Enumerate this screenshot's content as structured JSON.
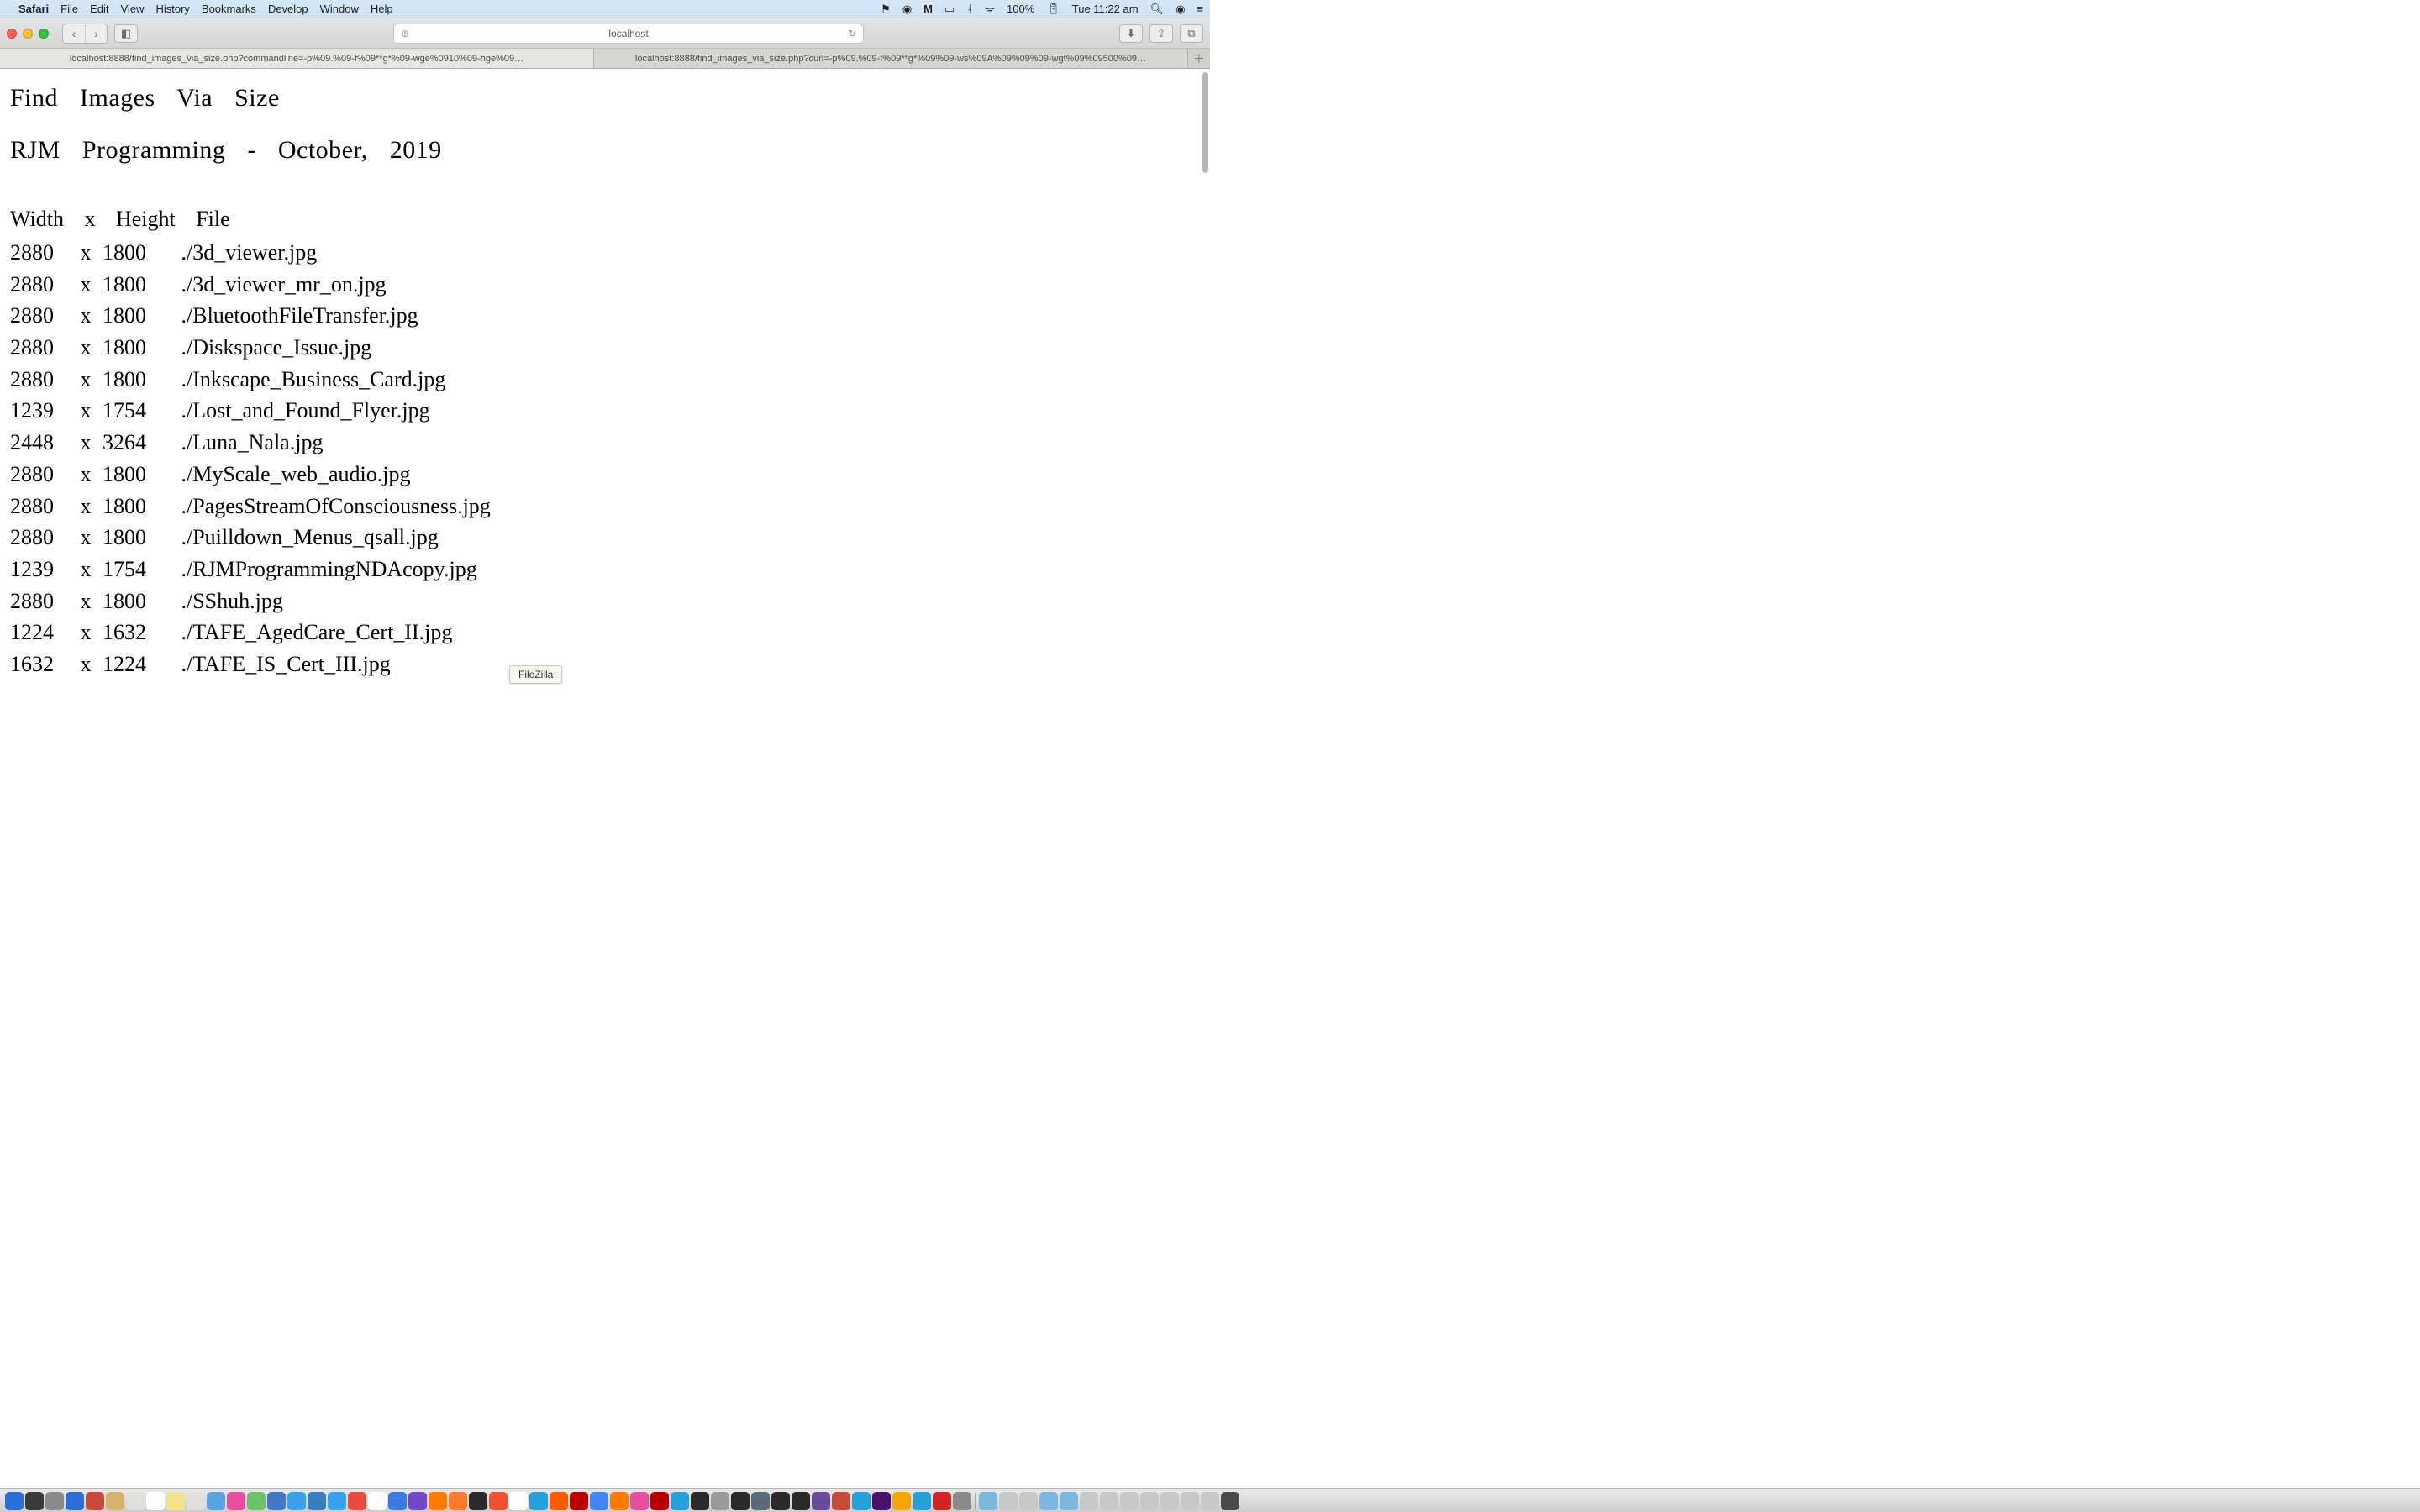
{
  "menubar": {
    "app": "Safari",
    "items": [
      "File",
      "Edit",
      "View",
      "History",
      "Bookmarks",
      "Develop",
      "Window",
      "Help"
    ],
    "battery": "100%",
    "clock": "Tue 11:22 am"
  },
  "toolbar": {
    "address": "localhost"
  },
  "tabs": [
    {
      "label": "localhost:8888/find_images_via_size.php?commandline=-p%09.%09-f%09**g*%09-wge%0910%09-hge%09…",
      "active": true
    },
    {
      "label": "localhost:8888/find_images_via_size.php?curl=-p%09.%09-f%09**g*%09%09-ws%09A%09%09%09-wgt%09%09500%09…",
      "active": false
    }
  ],
  "page": {
    "title": "Find   Images   Via   Size",
    "subtitle": "RJM   Programming   -   October,   2019",
    "columns": "Width   x   Height   File",
    "rows": [
      {
        "width": "2880",
        "height": "1800",
        "file": "./3d_viewer.jpg"
      },
      {
        "width": "2880",
        "height": "1800",
        "file": "./3d_viewer_mr_on.jpg"
      },
      {
        "width": "2880",
        "height": "1800",
        "file": "./BluetoothFileTransfer.jpg"
      },
      {
        "width": "2880",
        "height": "1800",
        "file": "./Diskspace_Issue.jpg"
      },
      {
        "width": "2880",
        "height": "1800",
        "file": "./Inkscape_Business_Card.jpg"
      },
      {
        "width": "1239",
        "height": "1754",
        "file": "./Lost_and_Found_Flyer.jpg"
      },
      {
        "width": "2448",
        "height": "3264",
        "file": "./Luna_Nala.jpg"
      },
      {
        "width": "2880",
        "height": "1800",
        "file": "./MyScale_web_audio.jpg"
      },
      {
        "width": "2880",
        "height": "1800",
        "file": "./PagesStreamOfConsciousness.jpg"
      },
      {
        "width": "2880",
        "height": "1800",
        "file": "./Puilldown_Menus_qsall.jpg"
      },
      {
        "width": "1239",
        "height": "1754",
        "file": "./RJMProgrammingNDAcopy.jpg"
      },
      {
        "width": "2880",
        "height": "1800",
        "file": "./SShuh.jpg"
      },
      {
        "width": "1224",
        "height": "1632",
        "file": "./TAFE_AgedCare_Cert_II.jpg"
      },
      {
        "width": "1632",
        "height": "1224",
        "file": "./TAFE_IS_Cert_III.jpg"
      }
    ]
  },
  "tooltip": "FileZilla",
  "dock_colors": [
    "#2a6fd6",
    "#3a3a3a",
    "#8a8a8a",
    "#2a6fd6",
    "#c74a3a",
    "#d7b36a",
    "#e0dfdc",
    "#ffffff",
    "#f0e38a",
    "#e0dfdc",
    "#5aa2e0",
    "#e84f9a",
    "#6ac36a",
    "#4178c5",
    "#39a0ed",
    "#3a7ec2",
    "#39a0ed",
    "#e74c3c",
    "#ffffff",
    "#3b7ae0",
    "#7048c8",
    "#ff7a00",
    "#ff7a2a",
    "#2a2a2a",
    "#f05133",
    "#ffffff",
    "#26a0da",
    "#ff5a00",
    "#b80000",
    "#4285f4",
    "#ff7a00",
    "#e84f9a",
    "#b80000",
    "#26a0da",
    "#2a2a2a",
    "#9a9a9a",
    "#2a2a2a",
    "#5a6a7a",
    "#2a2a2a",
    "#2a2a2a",
    "#6a4a9a",
    "#c74a3a",
    "#26a0da",
    "#4b0f6d",
    "#f7a600",
    "#26a0da",
    "#d02626",
    "#8a8a8a"
  ],
  "dock_colors_right": [
    "#7ab8e0",
    "#c8c8c8",
    "#c8c8c8",
    "#7ab8e0",
    "#7ab8e0",
    "#c8c8c8",
    "#c8c8c8",
    "#c8c8c8",
    "#c8c8c8",
    "#c8c8c8",
    "#c8c8c8",
    "#c8c8c8",
    "#4a4a4a"
  ]
}
